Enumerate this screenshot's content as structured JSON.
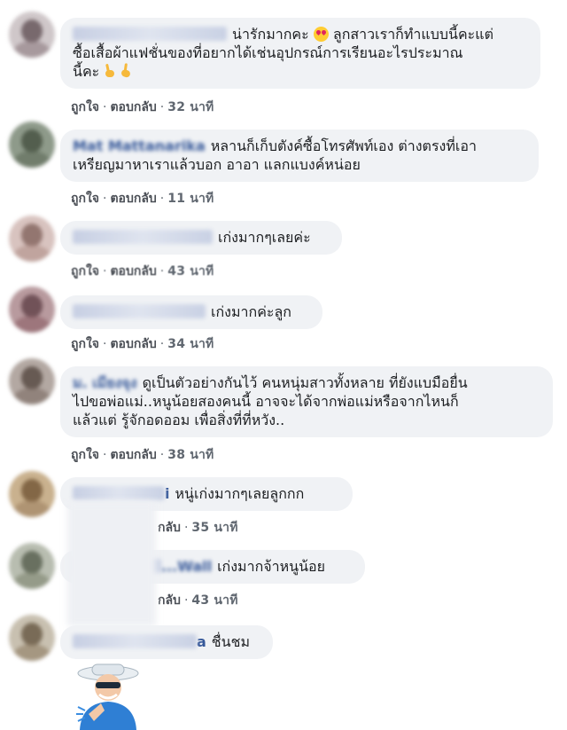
{
  "comments": [
    {
      "text": "น่ารักมากคะ",
      "text2": " ลูกสาวเราก็ทำแบบนี้คะแต่",
      "line2": "ซื้อเสื้อผ้าแฟชั่นของที่อยากได้เช่นอุปกรณ์การเรียนอะไรประมาณ",
      "line3": "นี้คะ",
      "like": "ถูกใจ",
      "reply": "ตอบกลับ",
      "time": "32 นาที"
    },
    {
      "name": "Mat Mattanarika",
      "text": "หลานก็เก็บตังค์ซื้อโทรศัพท์เอง ต่างตรงที่เอา",
      "line2": "เหรียญมาหาเราแล้วบอก อาอา แลกแบงค์หน่อย",
      "like": "ถูกใจ",
      "reply": "ตอบกลับ",
      "time": "11 นาที"
    },
    {
      "text": "เก่งมากๆเลยค่ะ",
      "like": "ถูกใจ",
      "reply": "ตอบกลับ",
      "time": "43 นาที"
    },
    {
      "text": "เก่งมากค่ะลูก",
      "like": "ถูกใจ",
      "reply": "ตอบกลับ",
      "time": "34 นาที"
    },
    {
      "name": "ม. เมียงจุง",
      "text": "ดูเป็นตัวอย่างกันไว้ คนหนุ่มสาวทั้งหลาย ที่ยังแบมือยื่น",
      "line2": "ไปขอพ่อแม่..หนูน้อยสองคนนี้ อาจจะได้จากพ่อแม่หรือจากไหนก็",
      "line3": "แล้วแต่ รู้จักอดออม เพื่อสิ่งที่ที่หวัง..",
      "like": "ถูกใจ",
      "reply": "ตอบกลับ",
      "time": "38 นาที"
    },
    {
      "name_tail": "i",
      "text": "หนู่เก่งมากๆเลยลูกกก",
      "reply_tail": "กลับ",
      "time": "35 นาที"
    },
    {
      "name_tail": "...Wall",
      "text": "เก่งมากจ้าหนูน้อย",
      "reply_tail": "กลับ",
      "time": "43 นาที"
    },
    {
      "name_tail": "a",
      "text": "ชื่นชม"
    }
  ]
}
